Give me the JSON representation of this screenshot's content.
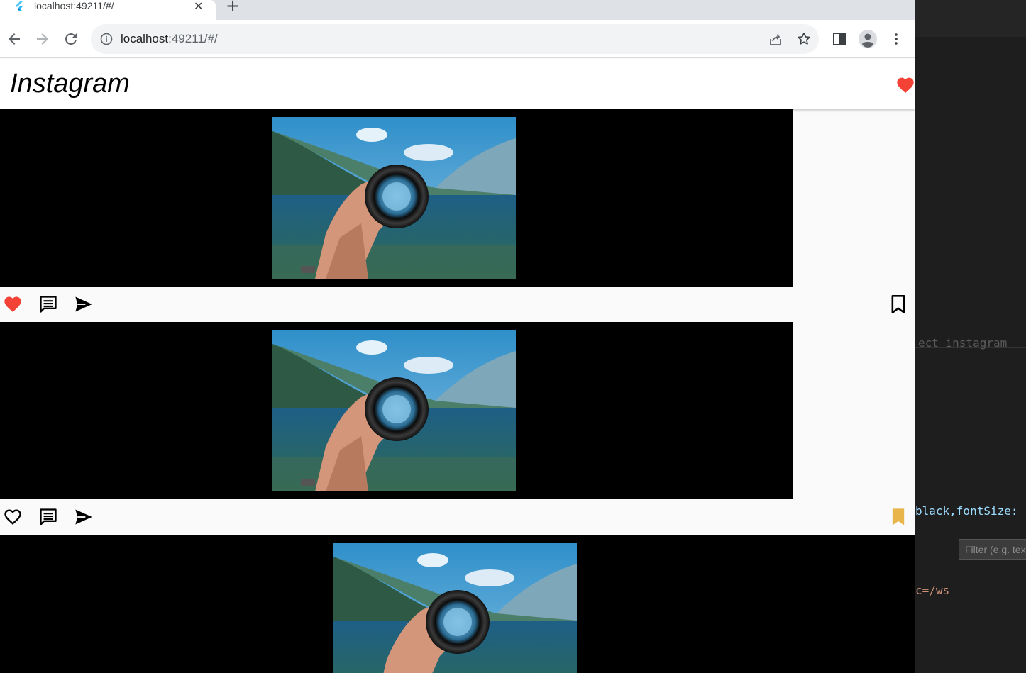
{
  "browser": {
    "tab_title": "localhost:49211/#/",
    "tab_close": "✕",
    "new_tab": "+",
    "url_host": "localhost",
    "url_rest": ":49211/#/"
  },
  "app": {
    "title": "Instagram",
    "header_icon": "heart-filled-icon",
    "colors": {
      "like": "#f44336",
      "saved": "#e8b54a",
      "image_bg": "#000000"
    }
  },
  "posts": [
    {
      "liked": true,
      "saved": false,
      "icons": [
        "heart-filled-icon",
        "comment-icon",
        "send-icon",
        "bookmark-outline-icon"
      ]
    },
    {
      "liked": false,
      "saved": true,
      "icons": [
        "heart-outline-icon",
        "comment-icon",
        "send-icon",
        "bookmark-filled-icon"
      ]
    },
    {
      "liked": false,
      "saved": false,
      "icons": []
    }
  ],
  "editor": {
    "line1": "ect instagram",
    "line2": "black,fontSize:",
    "filter_placeholder": "Filter (e.g. text",
    "line3": "c=/ws"
  }
}
